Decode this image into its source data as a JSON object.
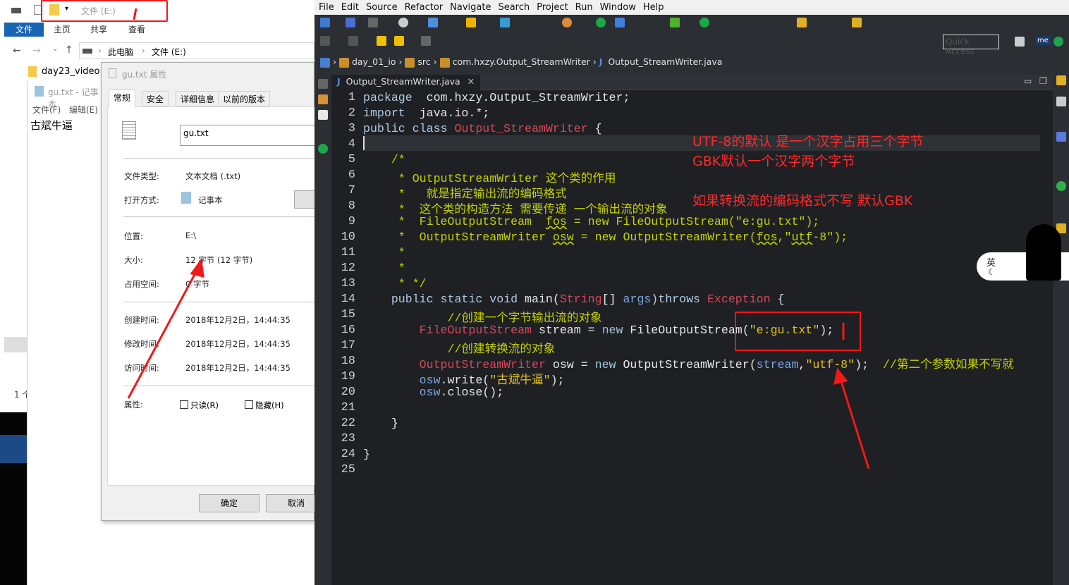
{
  "explorer": {
    "quick_access_title": "文件 (E:)",
    "ribbon_tabs": [
      "文件",
      "主页",
      "共享",
      "查看"
    ],
    "breadcrumb": [
      "此电脑",
      "文件 (E:)"
    ],
    "folder_item": "day23_video",
    "status_fragment": "1 个"
  },
  "notepad": {
    "title": "gu.txt - 记事本",
    "menu": [
      "文件(F)",
      "编辑(E)"
    ],
    "content": "古斌牛逼"
  },
  "properties": {
    "title": "gu.txt 属性",
    "tabs": [
      "常规",
      "安全",
      "详细信息",
      "以前的版本"
    ],
    "filename": "gu.txt",
    "rows": [
      {
        "label": "文件类型:",
        "value": "文本文档 (.txt)"
      },
      {
        "label": "打开方式:",
        "value": "记事本"
      },
      {
        "label": "位置:",
        "value": "E:\\"
      },
      {
        "label": "大小:",
        "value": "12 字节 (12 字节)"
      },
      {
        "label": "占用空间:",
        "value": "0 字节"
      },
      {
        "label": "创建时间:",
        "value": "2018年12月2日，14:44:35"
      },
      {
        "label": "修改时间:",
        "value": "2018年12月2日，14:44:35"
      },
      {
        "label": "访问时间:",
        "value": "2018年12月2日，14:44:35"
      }
    ],
    "attributes_label": "属性:",
    "readonly": "只读(R)",
    "hidden": "隐藏(H)",
    "ok": "确定",
    "cancel": "取消"
  },
  "eclipse": {
    "menu": [
      "File",
      "Edit",
      "Source",
      "Refactor",
      "Navigate",
      "Search",
      "Project",
      "Run",
      "Window",
      "Help"
    ],
    "quick_access": "Quick Access",
    "breadcrumb": [
      "day_01_io",
      "src",
      "com.hxzy.Output_StreamWriter",
      "Output_StreamWriter.java"
    ],
    "tab": "Output_StreamWriter.java",
    "code": [
      [
        [
          "k",
          "package"
        ],
        [
          "",
          "  com.hxzy.Output_StreamWriter;"
        ]
      ],
      [
        [
          "k",
          "import"
        ],
        [
          "",
          "  java.io.*;"
        ]
      ],
      [
        [
          "k",
          "public class "
        ],
        [
          "t",
          "Output_StreamWriter"
        ],
        [
          "",
          " {"
        ]
      ],
      [],
      [
        [
          "c",
          "    /*"
        ]
      ],
      [
        [
          "c",
          "     * OutputStreamWriter 这个类的作用"
        ]
      ],
      [
        [
          "c",
          "     *   就是指定输出流的编码格式"
        ]
      ],
      [
        [
          "c",
          "     *  这个类的构造方法 需要传递 一个输出流的对象"
        ]
      ],
      [
        [
          "c",
          "     *  FileOutputStream  "
        ],
        [
          "cu",
          "fos"
        ],
        [
          "c",
          " = new FileOutputStream(\"e:gu.txt\");"
        ]
      ],
      [
        [
          "c",
          "     *  OutputStreamWriter "
        ],
        [
          "cu",
          "osw"
        ],
        [
          "c",
          " = new OutputStreamWriter("
        ],
        [
          "cu",
          "fos"
        ],
        [
          "c",
          ",\""
        ],
        [
          "cu",
          "utf"
        ],
        [
          "c",
          "-8\");"
        ]
      ],
      [
        [
          "c",
          "     *"
        ]
      ],
      [
        [
          "c",
          "     *"
        ]
      ],
      [
        [
          "c",
          "     * */"
        ]
      ],
      [
        [
          "k",
          "    public static void "
        ],
        [
          "",
          "main("
        ],
        [
          "t",
          "String"
        ],
        [
          "",
          "[] "
        ],
        [
          "v",
          "args"
        ],
        [
          "k",
          ")throws "
        ],
        [
          "t",
          "Exception"
        ],
        [
          "",
          " {"
        ]
      ],
      [
        [
          "c",
          "            //创建一个字节输出流的对象"
        ]
      ],
      [
        [
          "t",
          "        FileOutputStream"
        ],
        [
          "",
          " stream = "
        ],
        [
          "n",
          "new"
        ],
        [
          "",
          " FileOutputStream("
        ],
        [
          "s",
          "\"e:gu.txt\""
        ],
        [
          "",
          ");"
        ]
      ],
      [
        [
          "c",
          "            //创建转换流的对象"
        ]
      ],
      [
        [
          "t",
          "        OutputStreamWriter"
        ],
        [
          "",
          " osw = "
        ],
        [
          "n",
          "new"
        ],
        [
          "",
          " OutputStreamWriter("
        ],
        [
          "v",
          "stream"
        ],
        [
          "",
          ","
        ],
        [
          "s",
          "\"utf-8\""
        ],
        [
          "",
          ");  "
        ],
        [
          "c",
          "//第二个参数如果不写就"
        ]
      ],
      [
        [
          "v",
          "        osw"
        ],
        [
          "",
          ".write("
        ],
        [
          "s",
          "\"古斌牛逼\""
        ],
        [
          "",
          ");"
        ]
      ],
      [
        [
          "v",
          "        osw"
        ],
        [
          "",
          ".close();"
        ]
      ],
      [],
      [
        [
          "",
          "    }"
        ]
      ],
      [],
      [
        [
          "",
          "}"
        ]
      ],
      []
    ],
    "annotations": [
      "UTF-8的默认 是一个汉字占用三个字节",
      "GBK默认一个汉字两个字节",
      "如果转换流的编码格式不写  默认GBK"
    ],
    "ime": "英"
  },
  "colors": {
    "annotation": "#ff2a2a",
    "ribbon_file": "#1a64b4",
    "editor_bg": "#1e2024"
  }
}
